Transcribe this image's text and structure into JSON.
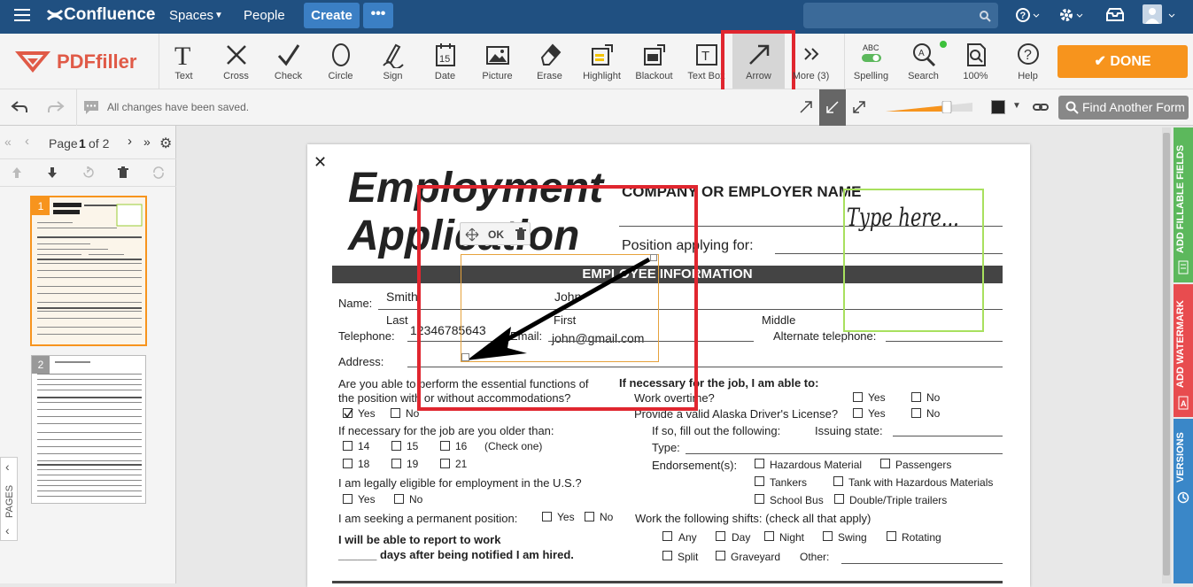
{
  "topbar": {
    "logo": "Confluence",
    "spaces": "Spaces",
    "people": "People",
    "create": "Create",
    "more": "•••"
  },
  "toolbar": {
    "brand": "PDFfiller",
    "tools": [
      "Text",
      "Cross",
      "Check",
      "Circle",
      "Sign",
      "Date",
      "Picture",
      "Erase",
      "Highlight",
      "Blackout",
      "Text Box",
      "Arrow",
      "More (3)",
      "Spelling",
      "Search",
      "100%",
      "Help"
    ],
    "date_icon_num": "15",
    "abc": "ABC",
    "done": "DONE"
  },
  "row2": {
    "status": "All changes have been saved.",
    "find": "Find Another Form"
  },
  "pages": {
    "page_label": "Page",
    "current": "1",
    "of_label": "of 2",
    "thumbs": [
      "1",
      "2"
    ],
    "side_label": "PAGES"
  },
  "arrow_popup": {
    "ok": "OK"
  },
  "sidetabs": [
    "ADD FILLABLE FIELDS",
    "ADD WATERMARK",
    "VERSIONS"
  ],
  "doc": {
    "title1": "Employment",
    "title2": "Application",
    "company": "COMPANY OR EMPLOYER NAME",
    "position": "Position applying for:",
    "section": "EMPLOYEE INFORMATION",
    "name_label": "Name:",
    "last_val": "Smith",
    "first_val": "John",
    "last": "Last",
    "first": "First",
    "middle": "Middle",
    "tel_label": "Telephone:",
    "tel_val": "12346785643",
    "email_label": "Email:",
    "email_val": "john@gmail.com",
    "alt_tel": "Alternate telephone:",
    "address": "Address:",
    "q1a": "Are you able to perform the essential functions of",
    "q1b": "the position with or without accommodations?",
    "yes": "Yes",
    "no": "No",
    "older": "If necessary for the job are you older than:",
    "a14": "14",
    "a15": "15",
    "a16": "16",
    "check_one": "(Check one)",
    "a18": "18",
    "a19": "19",
    "a21": "21",
    "legal": "I am legally eligible for employment in the U.S.?",
    "perm": "I am seeking a permanent position:",
    "report1": "I will be able to report to work",
    "report2": "______ days after being notified I am hired.",
    "ifnec": "If necessary for the job, I am able to:",
    "overtime": "Work overtime?",
    "license": "Provide a valid Alaska Driver's License?",
    "ifso": "If so, fill out the following:",
    "issuing": "Issuing state:",
    "type": "Type:",
    "endorse": "Endorsement(s):",
    "hazmat": "Hazardous Material",
    "passengers": "Passengers",
    "tankers": "Tankers",
    "tankhaz": "Tank with Hazardous Materials",
    "schoolbus": "School Bus",
    "double": "Double/Triple trailers",
    "shifts": "Work the following shifts: (check all that apply)",
    "any": "Any",
    "day": "Day",
    "night": "Night",
    "swing": "Swing",
    "rotating": "Rotating",
    "split": "Split",
    "graveyard": "Graveyard",
    "other": "Other:",
    "signature": "Type here..."
  }
}
